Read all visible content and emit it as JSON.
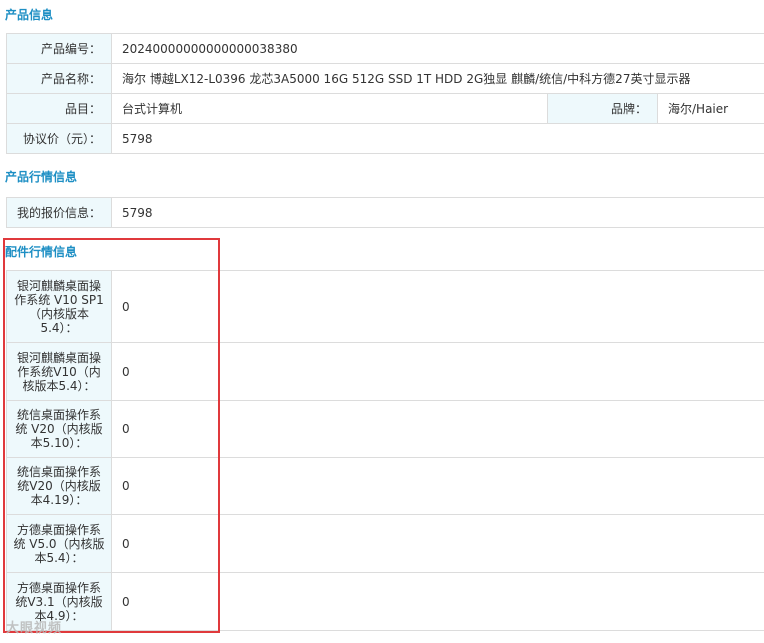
{
  "sections": {
    "product_info": "产品信息",
    "market_info": "产品行情信息",
    "parts_info": "配件行情信息"
  },
  "product": {
    "code_label": "产品编号：",
    "code": "20240000000000000038380",
    "name_label": "产品名称：",
    "name": "海尔 博越LX12-L0396 龙芯3A5000 16G 512G SSD 1T HDD 2G独显 麒麟/统信/中科方德27英寸显示器",
    "category_label": "品目：",
    "category": "台式计算机",
    "brand_label": "品牌：",
    "brand": "海尔/Haier",
    "price_label": "协议价（元）：",
    "price": "5798"
  },
  "market": {
    "my_quote_label": "我的报价信息：",
    "my_quote": "5798"
  },
  "parts": [
    {
      "label": "银河麒麟桌面操作系统 V10 SP1（内核版本5.4）：",
      "value": "0"
    },
    {
      "label": "银河麒麟桌面操作系统V10（内核版本5.4）：",
      "value": "0"
    },
    {
      "label": "统信桌面操作系统 V20（内核版本5.10）：",
      "value": "0"
    },
    {
      "label": "统信桌面操作系统V20（内核版本4.19）：",
      "value": "0"
    },
    {
      "label": "方德桌面操作系统 V5.0（内核版本5.4）：",
      "value": "0"
    },
    {
      "label": "方德桌面操作系统V3.1（内核版本4.9）：",
      "value": "0"
    }
  ],
  "watermark": "大眼视频"
}
